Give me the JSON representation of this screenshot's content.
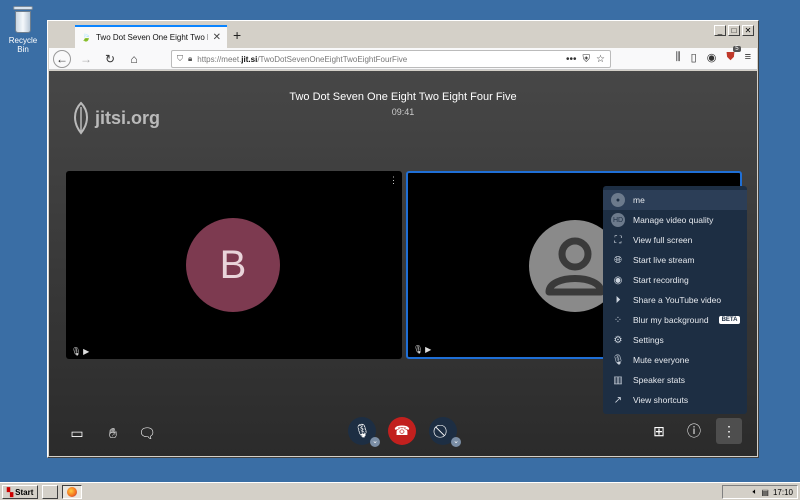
{
  "desktop": {
    "recycle_bin_label": "Recycle Bin"
  },
  "browser": {
    "tab_title": "Two Dot Seven One Eight Two Eig",
    "url_prefix": "https://meet.",
    "url_domain": "jit.si",
    "url_path": "/TwoDotSevenOneEightTwoEightFourFive",
    "notification_count": "5"
  },
  "meeting": {
    "logo_text": "jitsi.org",
    "title": "Two Dot Seven One Eight Two Eight Four Five",
    "time": "09:41",
    "remote_participant_initial": "B"
  },
  "menu": {
    "items": [
      {
        "label": "me",
        "icon": "avatar-icon"
      },
      {
        "label": "Manage video quality",
        "icon": "hd-icon",
        "icon_text": "HD"
      },
      {
        "label": "View full screen",
        "icon": "fullscreen-icon"
      },
      {
        "label": "Start live stream",
        "icon": "globe-icon"
      },
      {
        "label": "Start recording",
        "icon": "record-icon"
      },
      {
        "label": "Share a YouTube video",
        "icon": "play-icon"
      },
      {
        "label": "Blur my background",
        "icon": "blur-icon",
        "badge": "BETA"
      },
      {
        "label": "Settings",
        "icon": "gear-icon"
      },
      {
        "label": "Mute everyone",
        "icon": "mute-everyone-icon"
      },
      {
        "label": "Speaker stats",
        "icon": "stats-icon"
      },
      {
        "label": "View shortcuts",
        "icon": "shortcuts-icon"
      }
    ]
  },
  "taskbar": {
    "start_label": "Start",
    "clock": "17:10"
  },
  "colors": {
    "accent": "#1f6fd6",
    "hangup": "#c2201e",
    "menu_bg": "#1d2e43",
    "avatar_b": "#7d3a50"
  }
}
